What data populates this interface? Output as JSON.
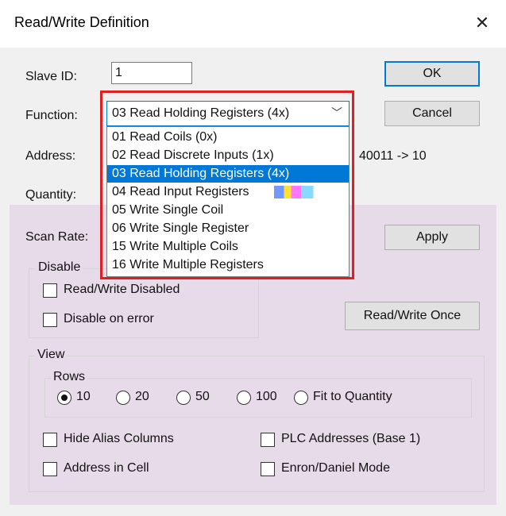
{
  "title": "Read/Write Definition",
  "slave_id": {
    "label": "Slave ID:",
    "value": "1"
  },
  "function": {
    "label": "Function:",
    "selected": "03 Read Holding Registers (4x)",
    "options": [
      "01 Read Coils (0x)",
      "02 Read Discrete Inputs (1x)",
      "03 Read Holding Registers (4x)",
      "04 Read Input Registers",
      "05 Write Single Coil",
      "06 Write Single Register",
      "15 Write Multiple Coils",
      "16 Write Multiple Registers"
    ],
    "selected_index": 2
  },
  "address": {
    "label": "Address:",
    "mapping": "40011 -> 10"
  },
  "quantity": {
    "label": "Quantity:"
  },
  "scan_rate": {
    "label": "Scan Rate:"
  },
  "buttons": {
    "ok": "OK",
    "cancel": "Cancel",
    "apply": "Apply",
    "once": "Read/Write Once"
  },
  "disable": {
    "legend": "Disable",
    "rw_disabled": "Read/Write Disabled",
    "on_error": "Disable on error"
  },
  "view": {
    "legend": "View",
    "rows_legend": "Rows",
    "rows": [
      "10",
      "20",
      "50",
      "100",
      "Fit to Quantity"
    ],
    "rows_selected": "10",
    "hide_alias": "Hide Alias Columns",
    "address_in_cell": "Address in Cell",
    "plc_addresses": "PLC Addresses (Base 1)",
    "enron": "Enron/Daniel Mode"
  },
  "colors": {
    "selection": "#0078d7",
    "highlight_box": "#e02020",
    "panel": "#e8dbe9"
  }
}
